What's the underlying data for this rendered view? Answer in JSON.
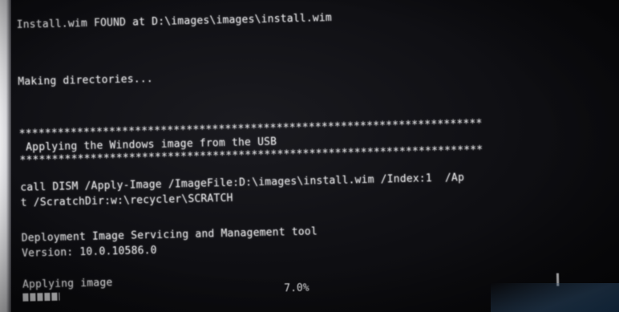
{
  "terminal": {
    "lines": [
      "Install.wim FOUND at D:\\images\\images\\install.wim",
      "Making directories...",
      "************************************************************************",
      " Applying the Windows image from the USB",
      "************************************************************************",
      "call DISM /Apply-Image /ImageFile:D:\\images\\install.wim /Index:1  /Ap",
      "t /ScratchDir:w:\\recycler\\SCRATCH",
      "Deployment Image Servicing and Management tool",
      "Version: 10.0.10586.0",
      "Applying image"
    ],
    "progress": {
      "label": "7.0%",
      "value": 0.07
    }
  },
  "colors": {
    "background": "#0e0e12",
    "text": "#e6e6e8",
    "bezel": "#f2f2f4"
  }
}
